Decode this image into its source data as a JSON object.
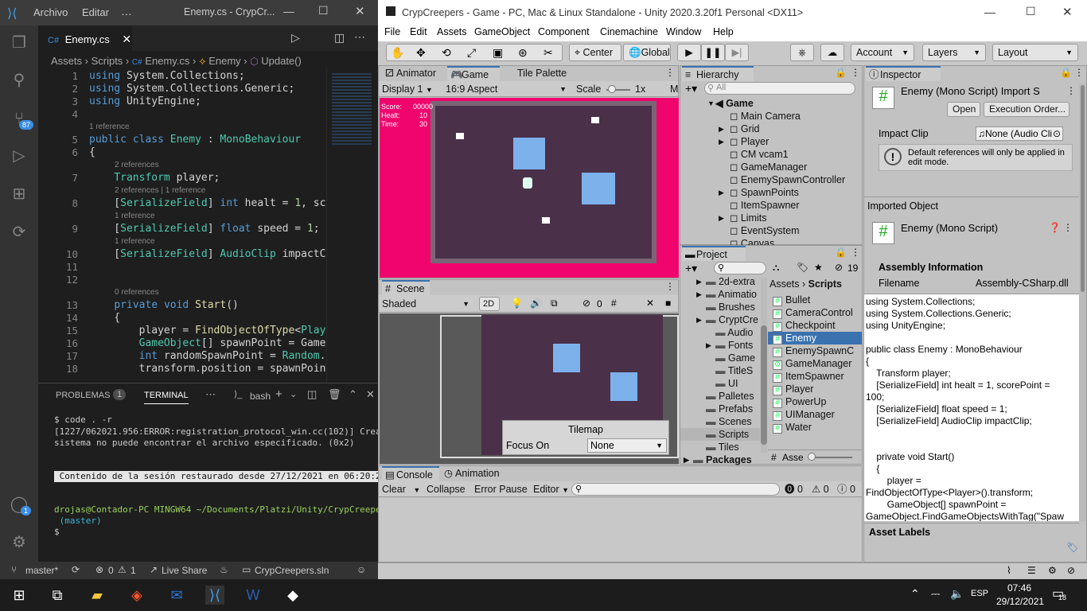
{
  "vscode": {
    "menu": [
      "Archivo",
      "Editar",
      "…"
    ],
    "window_title": "Enemy.cs - CrypCr...",
    "tab": {
      "label": "Enemy.cs",
      "icon": "csharp-icon"
    },
    "breadcrumb": [
      "Assets",
      "Scripts",
      "Enemy.cs",
      "Enemy",
      "Update()"
    ],
    "source_control_badge": "87",
    "line_numbers": [
      "1",
      "2",
      "3",
      "4",
      "5",
      "6",
      "7",
      "8",
      "9",
      "10",
      "11",
      "12",
      "13",
      "14",
      "15",
      "16",
      "17",
      "18"
    ],
    "code": [
      {
        "n": "1",
        "text": "using System.Collections;"
      },
      {
        "n": "2",
        "text": "using System.Collections.Generic;"
      },
      {
        "n": "3",
        "text": "using UnityEngine;"
      },
      {
        "n": "4",
        "text": ""
      },
      {
        "n": "5",
        "ref": "1 reference",
        "text": "public class Enemy : MonoBehaviour"
      },
      {
        "n": "6",
        "text": "{"
      },
      {
        "n": "7",
        "ref": "2 references",
        "text": "    Transform player;"
      },
      {
        "n": "8",
        "ref": "2 references | 1 reference",
        "text": "    [SerializeField] int healt = 1, scoreP"
      },
      {
        "n": "9",
        "ref": "1 reference",
        "text": "    [SerializeField] float speed = 1;"
      },
      {
        "n": "10",
        "ref": "1 reference",
        "text": "    [SerializeField] AudioClip impactClip;"
      },
      {
        "n": "11",
        "text": ""
      },
      {
        "n": "12",
        "text": ""
      },
      {
        "n": "13",
        "ref": "0 references",
        "text": "    private void Start()"
      },
      {
        "n": "14",
        "text": "    {"
      },
      {
        "n": "15",
        "text": "        player = FindObjectOfType<Player>("
      },
      {
        "n": "16",
        "text": "        GameObject[] spawnPoint = GameObje"
      },
      {
        "n": "17",
        "text": "        int randomSpawnPoint = Random.Ran"
      },
      {
        "n": "18",
        "text": "        transform.position = spawnPoint[ra"
      }
    ],
    "panel_tabs": {
      "problems": "PROBLEMAS",
      "problems_count": "1",
      "terminal": "TERMINAL",
      "shell": "bash"
    },
    "terminal": [
      "$ code . -r",
      "[1227/062021.956:ERROR:registration_protocol_win.cc(102)] Creat",
      "sistema no puede encontrar el archivo especificado. (0x2)",
      "",
      "",
      " Contenido de la sesión restaurado desde 27/12/2021 en 06:20:22",
      "",
      "",
      "drojas@Contador-PC MINGW64 ~/Documents/Platzi/Unity/CrypCreepers",
      " (master)",
      "$"
    ],
    "status": {
      "branch": "master*",
      "errors": "0",
      "warnings": "1",
      "live_share": "Live Share",
      "solution": "CrypCreepers.sln"
    },
    "account_badge": "1"
  },
  "unity": {
    "title": "CrypCreepers - Game - PC, Mac & Linux Standalone - Unity 2020.3.20f1 Personal <DX11>",
    "menu": [
      "File",
      "Edit",
      "Assets",
      "GameObject",
      "Component",
      "Cinemachine",
      "Window",
      "Help"
    ],
    "toolbar": {
      "center": "Center",
      "global": "Global",
      "account": "Account",
      "layers": "Layers",
      "layout": "Layout"
    },
    "game_tabs": [
      "Animator",
      "Game",
      "Tile Palette"
    ],
    "game_toolbar": {
      "display": "Display 1",
      "aspect": "16:9 Aspect",
      "scale_label": "Scale",
      "scale": "1x",
      "m": "M"
    },
    "hud": [
      {
        "label": "Score:",
        "value": "00000"
      },
      {
        "label": "Healt:",
        "value": "10"
      },
      {
        "label": "Time:",
        "value": "30"
      }
    ],
    "hierarchy": {
      "tab": "Hierarchy",
      "search": "All",
      "scene": "Game",
      "items": [
        "Main Camera",
        "Grid",
        "Player",
        "CM vcam1",
        "GameManager",
        "EnemySpawnController",
        "SpawnPoints",
        "ItemSpawner",
        "Limits",
        "EventSystem",
        "Canvas"
      ]
    },
    "scene": {
      "tab": "Scene",
      "shading": "Shaded",
      "mode2d": "2D",
      "hidden": "0",
      "overlay_title": "Tilemap",
      "focus_label": "Focus On",
      "focus_value": "None"
    },
    "project": {
      "tab": "Project",
      "count": "19",
      "breadcrumb": [
        "Assets",
        "Scripts"
      ],
      "tree": [
        "2d-extra",
        "Animatio",
        "Brushes",
        "CryptCre",
        "Audio",
        "Fonts",
        "Game",
        "TitleS",
        "UI",
        "Palletes",
        "Prefabs",
        "Scenes",
        "Scripts",
        "Tiles",
        "Packages"
      ],
      "files": [
        "Bullet",
        "CameraControl",
        "Checkpoint",
        "Enemy",
        "EnemySpawnC",
        "GameManager",
        "ItemSpawner",
        "Player",
        "PowerUp",
        "UIManager",
        "Water"
      ],
      "search_label": "Asse"
    },
    "inspector": {
      "tab": "Inspector",
      "header": "Enemy (Mono Script) Import S",
      "open": "Open",
      "exec": "Execution Order...",
      "impact_label": "Impact Clip",
      "impact_value": "None (Audio Cli",
      "note": "Default references will only be applied in edit mode.",
      "imported": "Imported Object",
      "script_name": "Enemy (Mono Script)",
      "assembly": "Assembly Information",
      "filename_label": "Filename",
      "filename_value": "Assembly-CSharp.dll",
      "preview": [
        "using System.Collections;",
        "using System.Collections.Generic;",
        "using UnityEngine;",
        "",
        "public class Enemy : MonoBehaviour",
        "{",
        "    Transform player;",
        "    [SerializeField] int healt = 1, scorePoint =",
        "100;",
        "    [SerializeField] float speed = 1;",
        "    [SerializeField] AudioClip impactClip;",
        "",
        "",
        "    private void Start()",
        "    {",
        "        player =",
        "FindObjectOfType<Player>().transform;",
        "        GameObject[] spawnPoint =",
        "GameObject.FindGameObjectsWithTag(\"Spaw"
      ],
      "labels": "Asset Labels"
    },
    "console": {
      "tabs": [
        "Console",
        "Animation"
      ],
      "clear": "Clear",
      "collapse": "Collapse",
      "error_pause": "Error Pause",
      "editor": "Editor",
      "counts": [
        "0",
        "0",
        "0"
      ]
    }
  },
  "taskbar": {
    "lang": "ESP",
    "time": "07:46",
    "date": "29/12/2021",
    "notif": "18"
  }
}
